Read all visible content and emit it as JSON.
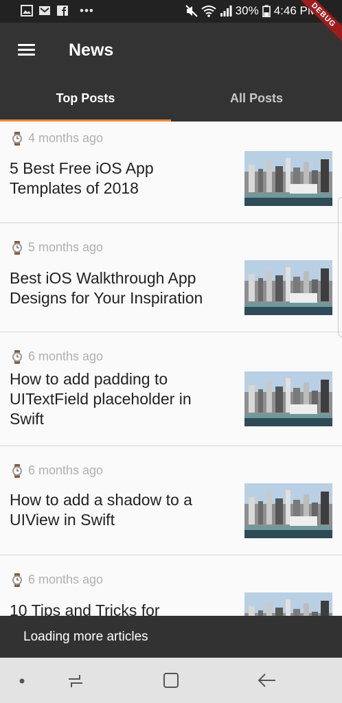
{
  "status_bar": {
    "battery": "30%",
    "time": "4:46 PM",
    "overflow_dots": "•••"
  },
  "debug_banner": "DEBUG",
  "app_bar": {
    "title": "News",
    "menu_icon": "hamburger-menu-icon"
  },
  "tabs": [
    {
      "label": "Top Posts",
      "active": true
    },
    {
      "label": "All Posts",
      "active": false
    }
  ],
  "articles": [
    {
      "time": "4 months ago",
      "title": "5 Best Free iOS App Templates of 2018"
    },
    {
      "time": "5 months ago",
      "title": "Best iOS Walkthrough App Designs for Your Inspiration"
    },
    {
      "time": "6 months ago",
      "title": "How to add padding to UITextField placeholder in Swift"
    },
    {
      "time": "6 months ago",
      "title": "How to add a shadow to a UIView in Swift"
    },
    {
      "time": "6 months ago",
      "title": "10 Tips and Tricks for"
    }
  ],
  "snackbar": {
    "message": "Loading more articles"
  },
  "colors": {
    "app_bar": "#333333",
    "tab_indicator": "#f0883a",
    "snackbar": "#323232",
    "time_text": "#b0b0b0"
  }
}
